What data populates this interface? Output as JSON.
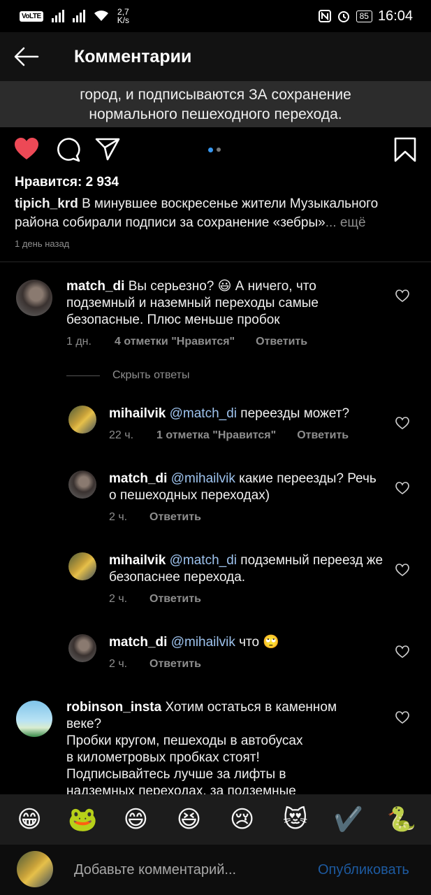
{
  "status_bar": {
    "volte": "VoLTE",
    "net_speed_value": "2,7",
    "net_speed_unit": "K/s",
    "battery": "85",
    "time": "16:04"
  },
  "header": {
    "title": "Комментарии"
  },
  "post": {
    "image_text_line1": "город, и подписываются ЗА сохранение",
    "image_text_line2": "нормального пешеходного перехода.",
    "likes": "Нравится: 2 934",
    "author": "tipich_krd",
    "caption": " В минувшее воскресенье жители Музыкального района собирали подписи за сохранение «зебры»",
    "more": "... ещё",
    "time": "1 день назад"
  },
  "comments": {
    "c1": {
      "user": "match_di",
      "text": " Вы серьезно? 😃 А ничего, что подземный и наземный переходы самые безопасные. Плюс меньше пробок",
      "time": "1 дн.",
      "likes": "4 отметки \"Нравится\"",
      "reply": "Ответить"
    },
    "hide_replies": "Скрыть ответы",
    "r1": {
      "user": "mihailvik",
      "mention": "@match_di",
      "text": " переезды может?",
      "time": "22 ч.",
      "likes": "1 отметка \"Нравится\"",
      "reply": "Ответить"
    },
    "r2": {
      "user": "match_di",
      "mention": "@mihailvik",
      "text": " какие переезды? Речь о пешеходных переходах)",
      "time": "2 ч.",
      "reply": "Ответить"
    },
    "r3": {
      "user": "mihailvik",
      "mention": "@match_di",
      "text": " подземный переезд же безопаснее перехода.",
      "time": "2 ч.",
      "reply": "Ответить"
    },
    "r4": {
      "user": "match_di",
      "mention": "@mihailvik",
      "text": " что 🙄",
      "time": "2 ч.",
      "reply": "Ответить"
    },
    "c2": {
      "user": "robinson_insta",
      "text1": " Хотим остаться в каменном веке?",
      "text2": "Пробки кругом, пешеходы в автобусах",
      "text3": "в километровых пробках стоят!",
      "text4": "Подписывайтесь лучше за лифты в",
      "text5": "надземных переходах, за подземные"
    }
  },
  "emoji_bar": [
    "😁",
    "🐸",
    "😄",
    "😆",
    "😢",
    "😻",
    "✔️",
    "🐍"
  ],
  "input": {
    "placeholder": "Добавьте комментарий...",
    "publish": "Опубликовать"
  },
  "colors": {
    "like_red": "#ed4956",
    "accent_blue": "#3797f0",
    "muted_blue": "#1d5aa0"
  }
}
